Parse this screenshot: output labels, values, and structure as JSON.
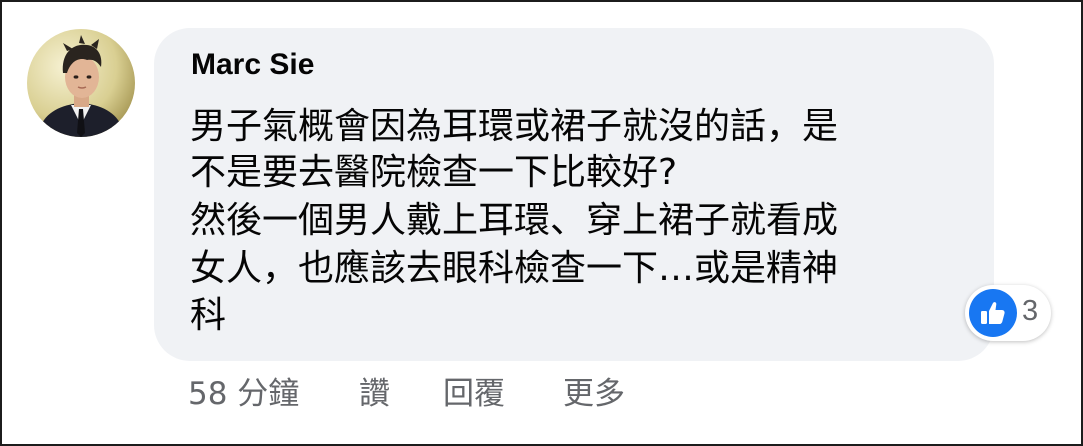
{
  "comment": {
    "author": "Marc Sie",
    "lines": [
      "男子氣概會因為耳環或裙子就沒的話，是",
      "不是要去醫院檢查一下比較好?",
      "然後一個男人戴上耳環、穿上裙子就看成",
      "女人，也應該去眼科檢查一下…或是精神",
      "科"
    ]
  },
  "reaction": {
    "icon": "thumbs-up-icon",
    "count": "3",
    "color": "#1877f2"
  },
  "actions": {
    "timestamp": "58 分鐘",
    "like_label": "讚",
    "reply_label": "回覆",
    "more_label": "更多"
  },
  "colors": {
    "bubble": "#f0f2f5",
    "text": "#050505",
    "secondary": "#65676b"
  }
}
